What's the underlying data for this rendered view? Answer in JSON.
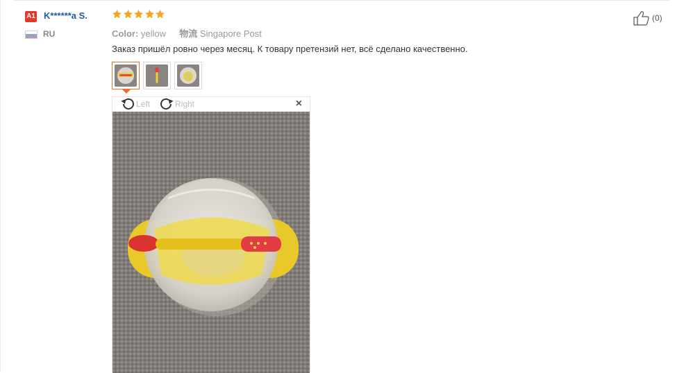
{
  "review": {
    "level_badge": "A1",
    "user_name": "K******a S.",
    "country": "RU",
    "rating": 5,
    "color_label": "Color:",
    "color_value": "yellow",
    "shipping_label": "物流",
    "shipping_value": "Singapore Post",
    "text": "Заказ пришёл ровно через месяц. К товару претензий нет, всё сделано качественно.",
    "likes": "(0)"
  },
  "viewer": {
    "rotate_left": "Left",
    "rotate_right": "Right",
    "close": "×"
  },
  "colors": {
    "accent": "#e8722d",
    "star": "#f7a423",
    "link": "#1f5aa6",
    "badge": "#e0392b"
  },
  "icons": [
    "star-icon",
    "thumbs-up-icon",
    "rotate-left-icon",
    "rotate-right-icon",
    "close-icon",
    "flag-ru-icon"
  ]
}
